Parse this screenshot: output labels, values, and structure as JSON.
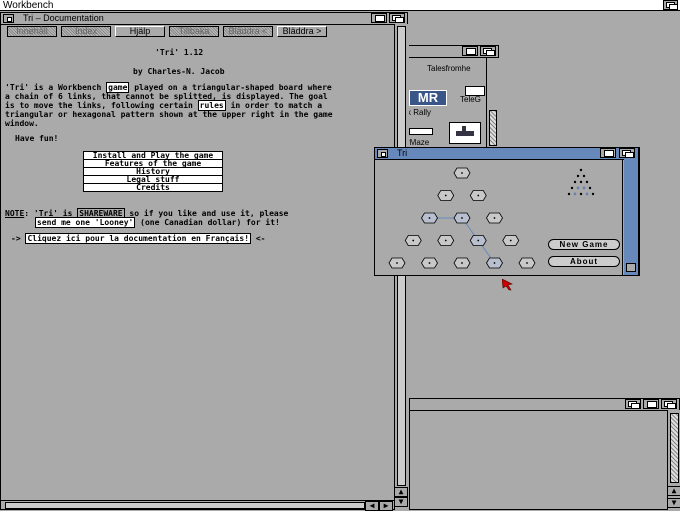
{
  "screen": {
    "title": "Workbench"
  },
  "doc_window": {
    "title": "Tri – Documentation",
    "nav_buttons": [
      {
        "label": "Innehåll",
        "enabled": false
      },
      {
        "label": "Index",
        "enabled": false
      },
      {
        "label": "Hjälp",
        "enabled": true
      },
      {
        "label": "Tillbaka",
        "enabled": false
      },
      {
        "label": "Bläddra <",
        "enabled": false
      },
      {
        "label": "Bläddra >",
        "enabled": true
      }
    ],
    "heading": "'Tri' 1.12",
    "author": "by Charles-N. Jacob",
    "para1_a": "'Tri' is a Workbench ",
    "para1_link": "game",
    "para1_b": " played on a triangular-shaped board where",
    "para1_line2": "a chain of 6 links, that cannot be splitted, is displayed. The goal",
    "para1_line3a": "is to move the links, following certain ",
    "para1_link2": "rules",
    "para1_line3b": " in order to match a",
    "para1_line4": "triangular or hexagonal pattern shown at the upper right in the game",
    "para1_line5": "window.",
    "have_fun": "Have fun!",
    "menu": [
      "Install and Play the game",
      "Features of the game",
      "History",
      "Legal stuff",
      "Credits"
    ],
    "note_label": "NOTE",
    "note_a": ": 'Tri' is ",
    "note_link": "SHAREWARE",
    "note_b": " so if you like and use it, please",
    "note_link2": "send me one 'Looney'",
    "note_c": " (one Canadian dollar) for it!",
    "fr_prefix": "-> ",
    "fr_link": "Cliquez ici pour la documentation en Français!",
    "fr_suffix": " <-"
  },
  "drawer_window": {
    "items": [
      {
        "label": "Talesfromhe"
      },
      {
        "label": "TeleG"
      },
      {
        "label": "x Rally"
      },
      {
        "label": "rMaze"
      }
    ]
  },
  "tri_window": {
    "title": "Tri",
    "buttons": {
      "new_game": "New Game",
      "about": "About"
    },
    "pieces": [
      {
        "col": 2,
        "row": 0,
        "state": "empty"
      },
      {
        "col": 1.5,
        "row": 1,
        "state": "empty"
      },
      {
        "col": 2.5,
        "row": 1,
        "state": "empty"
      },
      {
        "col": 1,
        "row": 2,
        "state": "link"
      },
      {
        "col": 2,
        "row": 2,
        "state": "link"
      },
      {
        "col": 3,
        "row": 2,
        "state": "empty"
      },
      {
        "col": 0.5,
        "row": 3,
        "state": "empty"
      },
      {
        "col": 1.5,
        "row": 3,
        "state": "empty"
      },
      {
        "col": 2.5,
        "row": 3,
        "state": "link"
      },
      {
        "col": 3.5,
        "row": 3,
        "state": "empty"
      },
      {
        "col": 0,
        "row": 4,
        "state": "empty"
      },
      {
        "col": 1,
        "row": 4,
        "state": "empty"
      },
      {
        "col": 2,
        "row": 4,
        "state": "empty"
      },
      {
        "col": 3,
        "row": 4,
        "state": "link"
      },
      {
        "col": 4,
        "row": 4,
        "state": "empty"
      }
    ]
  },
  "colors": {
    "desktop": "#aaaaaa",
    "active_title": "#6688bb",
    "link_line": "#6688bb",
    "pointer": "#cc0000"
  }
}
